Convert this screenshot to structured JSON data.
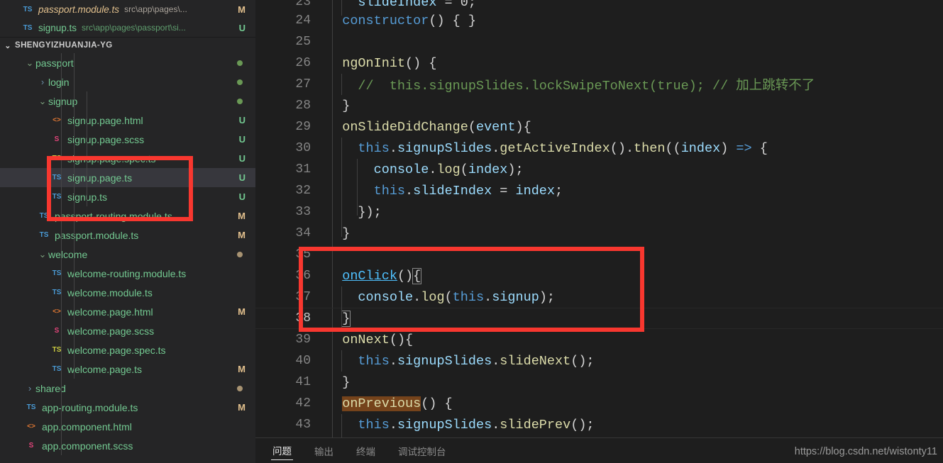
{
  "sidebar": {
    "open_editors": [
      {
        "icon": "ts-file-icon",
        "icon_label": "TS",
        "name": "passport.module.ts",
        "path": "src\\app\\pages\\...",
        "badge": "M"
      },
      {
        "icon": "ts-file-icon",
        "icon_label": "TS",
        "name": "signup.ts",
        "path": "src\\app\\pages\\passport\\si...",
        "badge": "U"
      }
    ],
    "section_title": "SHENGYIZHUANJIA-YG",
    "tree": [
      {
        "kind": "folder",
        "twisty": "chevron-down",
        "label": "passport",
        "indent": 1,
        "dot": "green",
        "badge": ""
      },
      {
        "kind": "folder",
        "twisty": "chevron-right",
        "label": "login",
        "indent": 2,
        "dot": "green",
        "badge": ""
      },
      {
        "kind": "folder",
        "twisty": "chevron-down",
        "label": "signup",
        "indent": 2,
        "dot": "green",
        "badge": ""
      },
      {
        "kind": "file",
        "icon": "html-file-icon",
        "icon_label": "<>",
        "label": "signup.page.html",
        "indent": 3,
        "badge": "U"
      },
      {
        "kind": "file",
        "icon": "scss-file-icon",
        "icon_label": "S",
        "label": "signup.page.scss",
        "indent": 3,
        "badge": "U"
      },
      {
        "kind": "file",
        "icon": "ts-spec-file-icon",
        "icon_label": "TS",
        "label": "signup.page.spec.ts",
        "indent": 3,
        "badge": "U"
      },
      {
        "kind": "file",
        "icon": "ts-file-icon",
        "icon_label": "TS",
        "label": "signup.page.ts",
        "indent": 3,
        "badge": "U",
        "selected": true
      },
      {
        "kind": "file",
        "icon": "ts-file-icon",
        "icon_label": "TS",
        "label": "signup.ts",
        "indent": 3,
        "badge": "U"
      },
      {
        "kind": "file",
        "icon": "ts-file-icon",
        "icon_label": "TS",
        "label": "passport-routing.module.ts",
        "indent": 2,
        "badge": "M"
      },
      {
        "kind": "file",
        "icon": "ts-file-icon",
        "icon_label": "TS",
        "label": "passport.module.ts",
        "indent": 2,
        "badge": "M"
      },
      {
        "kind": "folder",
        "twisty": "chevron-down",
        "label": "welcome",
        "indent": 2,
        "dot": "tan",
        "badge": ""
      },
      {
        "kind": "file",
        "icon": "ts-file-icon",
        "icon_label": "TS",
        "label": "welcome-routing.module.ts",
        "indent": 3,
        "badge": ""
      },
      {
        "kind": "file",
        "icon": "ts-file-icon",
        "icon_label": "TS",
        "label": "welcome.module.ts",
        "indent": 3,
        "badge": ""
      },
      {
        "kind": "file",
        "icon": "html-file-icon",
        "icon_label": "<>",
        "label": "welcome.page.html",
        "indent": 3,
        "badge": "M"
      },
      {
        "kind": "file",
        "icon": "scss-file-icon",
        "icon_label": "S",
        "label": "welcome.page.scss",
        "indent": 3,
        "badge": ""
      },
      {
        "kind": "file",
        "icon": "ts-spec-file-icon",
        "icon_label": "TS",
        "label": "welcome.page.spec.ts",
        "indent": 3,
        "badge": ""
      },
      {
        "kind": "file",
        "icon": "ts-file-icon",
        "icon_label": "TS",
        "label": "welcome.page.ts",
        "indent": 3,
        "badge": "M"
      },
      {
        "kind": "folder",
        "twisty": "chevron-right",
        "label": "shared",
        "indent": 1,
        "dot": "tan",
        "badge": ""
      },
      {
        "kind": "file",
        "icon": "ts-file-icon",
        "icon_label": "TS",
        "label": "app-routing.module.ts",
        "indent": 1,
        "badge": "M"
      },
      {
        "kind": "file",
        "icon": "html-file-icon",
        "icon_label": "<>",
        "label": "app.component.html",
        "indent": 1,
        "badge": ""
      },
      {
        "kind": "file",
        "icon": "scss-file-icon",
        "icon_label": "S",
        "label": "app.component.scss",
        "indent": 1,
        "badge": ""
      }
    ]
  },
  "editor": {
    "first_line_number": 23,
    "lines": [
      {
        "n": 23,
        "partial": true,
        "text": "    slideIndex = 0;"
      },
      {
        "n": 24,
        "text": "  constructor() { }"
      },
      {
        "n": 25,
        "text": ""
      },
      {
        "n": 26,
        "text": "  ngOnInit() {"
      },
      {
        "n": 27,
        "text": "    //  this.signupSlides.lockSwipeToNext(true); // 加上跳转不了"
      },
      {
        "n": 28,
        "text": "  }"
      },
      {
        "n": 29,
        "text": "  onSlideDidChange(event){"
      },
      {
        "n": 30,
        "text": "    this.signupSlides.getActiveIndex().then((index) => {"
      },
      {
        "n": 31,
        "text": "      console.log(index);"
      },
      {
        "n": 32,
        "text": "      this.slideIndex = index;"
      },
      {
        "n": 33,
        "text": "    });"
      },
      {
        "n": 34,
        "text": "  }"
      },
      {
        "n": 35,
        "text": ""
      },
      {
        "n": 36,
        "text": "  onClick(){"
      },
      {
        "n": 37,
        "text": "    console.log(this.signup);"
      },
      {
        "n": 38,
        "text": "  }",
        "current": true
      },
      {
        "n": 39,
        "text": "  onNext(){"
      },
      {
        "n": 40,
        "text": "    this.signupSlides.slideNext();"
      },
      {
        "n": 41,
        "text": "  }"
      },
      {
        "n": 42,
        "text": "  onPrevious() {"
      },
      {
        "n": 43,
        "text": "    this.signupSlides.slidePrev();"
      }
    ]
  },
  "panel": {
    "tabs": [
      {
        "label": "问题",
        "active": true
      },
      {
        "label": "输出",
        "active": false
      },
      {
        "label": "终端",
        "active": false
      },
      {
        "label": "调试控制台",
        "active": false
      }
    ]
  },
  "watermark": {
    "text": "https://blog.csdn.net/wistonty11"
  },
  "colors": {
    "annotation_red": "#f8372f",
    "editor_bg": "#1e1e1e",
    "sidebar_bg": "#252526",
    "selection_bg": "#37373d",
    "find_match_bg": "#75431b",
    "modified_badge": "#e2c08d",
    "untracked_badge": "#73c991"
  }
}
